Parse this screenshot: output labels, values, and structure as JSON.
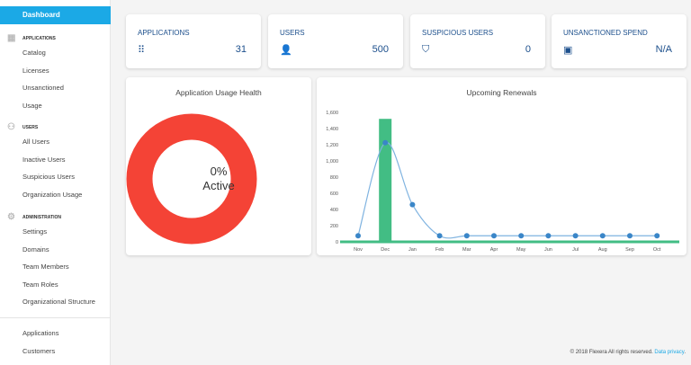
{
  "sidebar": {
    "active": "Dashboard",
    "sections": [
      {
        "title": "APPLICATIONS",
        "icon": "applications-icon",
        "items": [
          "Catalog",
          "Licenses",
          "Unsanctioned",
          "Usage"
        ]
      },
      {
        "title": "USERS",
        "icon": "users-icon",
        "items": [
          "All Users",
          "Inactive Users",
          "Suspicious Users",
          "Organization Usage"
        ]
      },
      {
        "title": "ADMINISTRATION",
        "icon": "gear-icon",
        "items": [
          "Settings",
          "Domains",
          "Team Members",
          "Team Roles",
          "Organizational Structure"
        ]
      }
    ],
    "bottom": [
      "Applications",
      "Customers"
    ]
  },
  "stats": [
    {
      "label": "APPLICATIONS",
      "value": "31",
      "icon": "grid-icon"
    },
    {
      "label": "USERS",
      "value": "500",
      "icon": "user-icon"
    },
    {
      "label": "SUSPICIOUS USERS",
      "value": "0",
      "icon": "shield-icon"
    },
    {
      "label": "UNSANCTIONED SPEND",
      "value": "N/A",
      "icon": "money-icon"
    }
  ],
  "health": {
    "title": "Application Usage Health",
    "percent": "0%",
    "label": "Active",
    "color": "#f44336"
  },
  "chart_data": {
    "type": "bar",
    "title": "Upcoming Renewals",
    "categories": [
      "Nov",
      "Dec",
      "Jan",
      "Feb",
      "Mar",
      "Apr",
      "May",
      "Jun",
      "Jul",
      "Aug",
      "Sep",
      "Oct"
    ],
    "series": [
      {
        "type": "bar",
        "color": "#42bd84",
        "values": [
          0,
          1520,
          0,
          0,
          0,
          0,
          0,
          0,
          0,
          0,
          0,
          0
        ]
      },
      {
        "type": "line",
        "color": "#3a86c8",
        "values": [
          75,
          1225,
          460,
          75,
          75,
          75,
          75,
          75,
          75,
          75,
          75,
          75
        ]
      }
    ],
    "ylim": [
      0,
      1600
    ],
    "yticks": [
      "0",
      "200",
      "400",
      "600",
      "800",
      "1,000",
      "1,200",
      "1,400",
      "1,600"
    ]
  },
  "footer": {
    "text": "© 2018 Flexera All rights reserved.",
    "link": "Data privacy",
    "end": "."
  }
}
